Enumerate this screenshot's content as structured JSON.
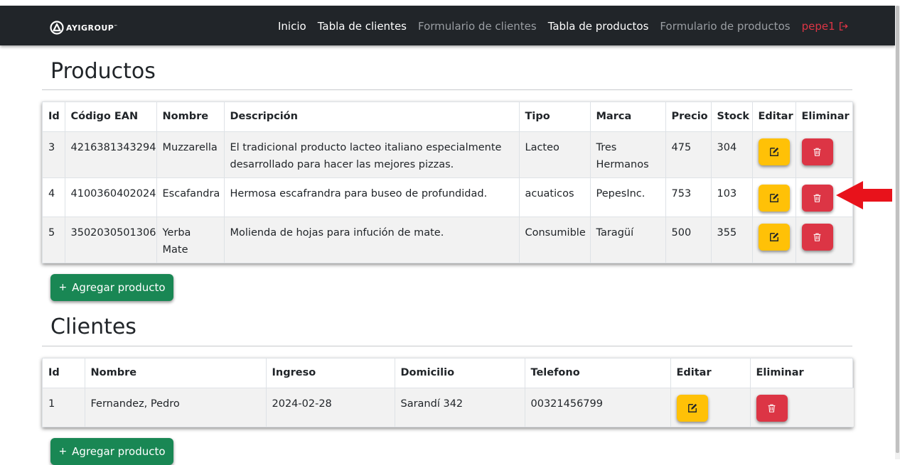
{
  "navbar": {
    "brand": "AYIGROUP",
    "brand_mark": "™",
    "links": [
      {
        "label": "Inicio"
      },
      {
        "label": "Tabla de clientes"
      },
      {
        "label": "Formulario de clientes"
      },
      {
        "label": "Tabla de productos"
      },
      {
        "label": "Formulario de productos"
      }
    ],
    "user": "pepe1",
    "logout_icon": "logout-icon"
  },
  "productos": {
    "title": "Productos",
    "columns": [
      "Id",
      "Código EAN",
      "Nombre",
      "Descripción",
      "Tipo",
      "Marca",
      "Precio",
      "Stock",
      "Editar",
      "Eliminar"
    ],
    "rows": [
      {
        "id": "3",
        "ean": "4216381343294",
        "nombre": "Muzzarella",
        "descripcion": "El tradicional producto lacteo italiano especialmente desarrollado para hacer las mejores pizzas.",
        "tipo": "Lacteo",
        "marca": "Tres Hermanos",
        "precio": "475",
        "stock": "304"
      },
      {
        "id": "4",
        "ean": "4100360402024",
        "nombre": "Escafandra",
        "descripcion": "Hermosa escafrandra para buseo de profundidad.",
        "tipo": "acuaticos",
        "marca": "PepesInc.",
        "precio": "753",
        "stock": "103"
      },
      {
        "id": "5",
        "ean": "3502030501306",
        "nombre": "Yerba Mate",
        "descripcion": "Molienda de hojas para infución de mate.",
        "tipo": "Consumible",
        "marca": "Taragüí",
        "precio": "500",
        "stock": "355"
      }
    ],
    "add_label": "Agregar producto"
  },
  "clientes": {
    "title": "Clientes",
    "columns": [
      "Id",
      "Nombre",
      "Ingreso",
      "Domicilio",
      "Telefono",
      "Editar",
      "Eliminar"
    ],
    "rows": [
      {
        "id": "1",
        "nombre": "Fernandez, Pedro",
        "ingreso": "2024-02-28",
        "domicilio": "Sarandí 342",
        "telefono": "00321456799"
      }
    ],
    "add_label": "Agregar producto"
  },
  "icons": {
    "edit": "edit-icon",
    "delete": "trash-icon",
    "add": "plus-icon",
    "annotation": "red-arrow-icon"
  },
  "colors": {
    "navbar": "#212529",
    "edit": "#ffc107",
    "delete": "#dc3545",
    "add": "#198754",
    "user": "#dc3545"
  }
}
